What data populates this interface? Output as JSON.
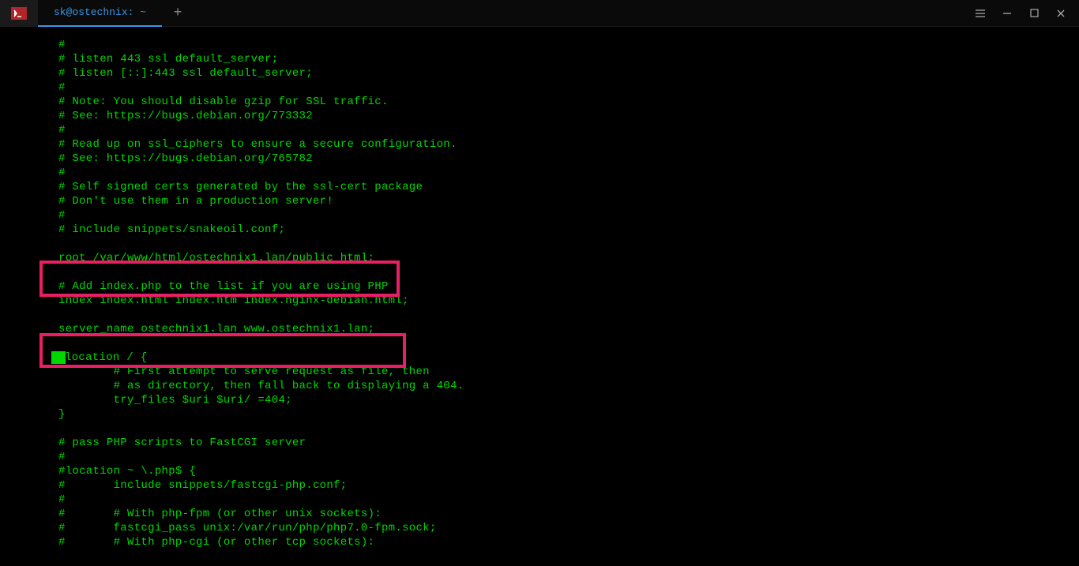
{
  "titlebar": {
    "tab_title": "sk@ostechnix: ~",
    "new_tab": "+"
  },
  "terminal": {
    "lines": [
      "#",
      "# listen 443 ssl default_server;",
      "# listen [::]:443 ssl default_server;",
      "#",
      "# Note: You should disable gzip for SSL traffic.",
      "# See: https://bugs.debian.org/773332",
      "#",
      "# Read up on ssl_ciphers to ensure a secure configuration.",
      "# See: https://bugs.debian.org/765782",
      "#",
      "# Self signed certs generated by the ssl-cert package",
      "# Don't use them in a production server!",
      "#",
      "# include snippets/snakeoil.conf;",
      "",
      "root /var/www/html/ostechnix1.lan/public_html;",
      "",
      "# Add index.php to the list if you are using PHP",
      "index index.html index.htm index.nginx-debian.html;",
      "",
      "server_name ostechnix1.lan www.ostechnix1.lan;",
      "",
      "location / {",
      "        # First attempt to serve request as file, then",
      "        # as directory, then fall back to displaying a 404.",
      "        try_files $uri $uri/ =404;",
      "}",
      "",
      "# pass PHP scripts to FastCGI server",
      "#",
      "#location ~ \\.php$ {",
      "#       include snippets/fastcgi-php.conf;",
      "#",
      "#       # With php-fpm (or other unix sockets):",
      "#       fastcgi_pass unix:/var/run/php/php7.0-fpm.sock;",
      "#       # With php-cgi (or other tcp sockets):"
    ]
  }
}
